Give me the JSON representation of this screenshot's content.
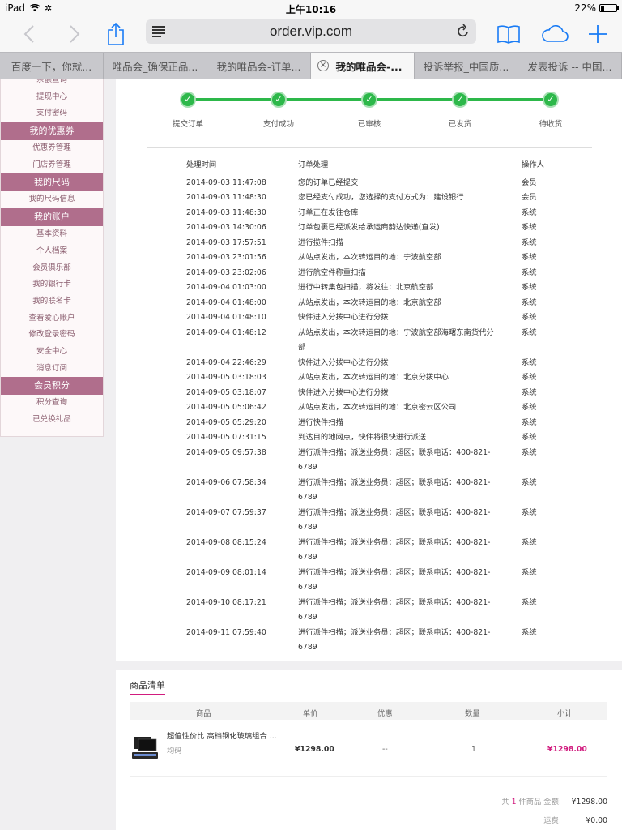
{
  "status": {
    "device": "iPad",
    "time": "上午10:16",
    "battery": "22%",
    "battery_level": 0.22
  },
  "browser": {
    "url": "order.vip.com",
    "tabs": [
      {
        "label": "百度一下，你就...",
        "active": false
      },
      {
        "label": "唯品会_确保正品...",
        "active": false
      },
      {
        "label": "我的唯品会-订单...",
        "active": false
      },
      {
        "label": "我的唯品会-...",
        "active": true
      },
      {
        "label": "投诉举报_中国质...",
        "active": false
      },
      {
        "label": "发表投诉 -- 中国...",
        "active": false
      }
    ]
  },
  "sidebar": {
    "groups": [
      {
        "header": null,
        "items": [
          "余额查询",
          "提现中心",
          "支付密码"
        ]
      },
      {
        "header": "我的优惠券",
        "items": [
          "优惠券管理",
          "门店券管理"
        ]
      },
      {
        "header": "我的尺码",
        "items": [
          "我的尺码信息"
        ]
      },
      {
        "header": "我的账户",
        "items": [
          "基本资料",
          "个人档案",
          "会员俱乐部",
          "我的银行卡",
          "我的联名卡",
          "查看爱心账户",
          "修改登录密码",
          "安全中心",
          "消息订阅"
        ]
      },
      {
        "header": "会员积分",
        "items": [
          "积分查询",
          "已兑换礼品"
        ]
      }
    ]
  },
  "steps": [
    "提交订单",
    "支付成功",
    "已审核",
    "已发货",
    "待收货"
  ],
  "log": {
    "headers": {
      "time": "处理时间",
      "action": "订单处理",
      "operator": "操作人"
    },
    "rows": [
      {
        "time": "2014-09-03 11:47:08",
        "action": "您的订单已经提交",
        "operator": "会员"
      },
      {
        "time": "2014-09-03 11:48:30",
        "action": "您已经支付成功，您选择的支付方式为：建设银行",
        "operator": "会员"
      },
      {
        "time": "2014-09-03 11:48:30",
        "action": "订单正在发往仓库",
        "operator": "系统"
      },
      {
        "time": "2014-09-03 14:30:06",
        "action": "订单包裹已经派发给承运商韵达快递(直发)",
        "operator": "系统"
      },
      {
        "time": "2014-09-03 17:57:51",
        "action": "进行揽件扫描",
        "operator": "系统"
      },
      {
        "time": "2014-09-03 23:01:56",
        "action": "从站点发出，本次转运目的地：宁波航空部",
        "operator": "系统"
      },
      {
        "time": "2014-09-03 23:02:06",
        "action": "进行航空件称重扫描",
        "operator": "系统"
      },
      {
        "time": "2014-09-04 01:03:00",
        "action": "进行中转集包扫描，将发往：北京航空部",
        "operator": "系统"
      },
      {
        "time": "2014-09-04 01:48:00",
        "action": "从站点发出，本次转运目的地：北京航空部",
        "operator": "系统"
      },
      {
        "time": "2014-09-04 01:48:10",
        "action": "快件进入分拨中心进行分拨",
        "operator": "系统"
      },
      {
        "time": "2014-09-04 01:48:12",
        "action": "从站点发出，本次转运目的地：宁波航空部海曙东南货代分部",
        "operator": "系统"
      },
      {
        "time": "2014-09-04 22:46:29",
        "action": "快件进入分拨中心进行分拨",
        "operator": "系统"
      },
      {
        "time": "2014-09-05 03:18:03",
        "action": "从站点发出，本次转运目的地：北京分拨中心",
        "operator": "系统"
      },
      {
        "time": "2014-09-05 03:18:07",
        "action": "快件进入分拨中心进行分拨",
        "operator": "系统"
      },
      {
        "time": "2014-09-05 05:06:42",
        "action": "从站点发出，本次转运目的地：北京密云区公司",
        "operator": "系统"
      },
      {
        "time": "2014-09-05 05:29:20",
        "action": "进行快件扫描",
        "operator": "系统"
      },
      {
        "time": "2014-09-05 07:31:15",
        "action": "到达目的地网点，快件将很快进行派送",
        "operator": "系统"
      },
      {
        "time": "2014-09-05 09:57:38",
        "action": "进行派件扫描；派送业务员：超区；联系电话：400-821-6789",
        "operator": "系统"
      },
      {
        "time": "2014-09-06 07:58:34",
        "action": "进行派件扫描；派送业务员：超区；联系电话：400-821-6789",
        "operator": "系统"
      },
      {
        "time": "2014-09-07 07:59:37",
        "action": "进行派件扫描；派送业务员：超区；联系电话：400-821-6789",
        "operator": "系统"
      },
      {
        "time": "2014-09-08 08:15:24",
        "action": "进行派件扫描；派送业务员：超区；联系电话：400-821-6789",
        "operator": "系统"
      },
      {
        "time": "2014-09-09 08:01:14",
        "action": "进行派件扫描；派送业务员：超区；联系电话：400-821-6789",
        "operator": "系统"
      },
      {
        "time": "2014-09-10 08:17:21",
        "action": "进行派件扫描；派送业务员：超区；联系电话：400-821-6789",
        "operator": "系统"
      },
      {
        "time": "2014-09-11 07:59:40",
        "action": "进行派件扫描；派送业务员：超区；联系电话：400-821-6789",
        "operator": "系统"
      }
    ]
  },
  "goods": {
    "title": "商品清单",
    "headers": {
      "product": "商品",
      "price": "单价",
      "discount": "优惠",
      "qty": "数量",
      "subtotal": "小计"
    },
    "item": {
      "name": "超值性价比 高档钢化玻璃组合 ...",
      "spec": "均码",
      "price": "¥1298.00",
      "discount": "--",
      "qty": "1",
      "subtotal": "¥1298.00"
    },
    "summary": {
      "count_prefix": "共",
      "count": "1",
      "count_suffix": "件商品 金额:",
      "amount": "¥1298.00",
      "shipping_label": "运费:",
      "shipping": "¥0.00"
    }
  },
  "colors": {
    "accent": "#1a7cf5",
    "progress": "#2db84a",
    "sidebar_head": "#b06e8c",
    "price": "#d11b7e"
  }
}
